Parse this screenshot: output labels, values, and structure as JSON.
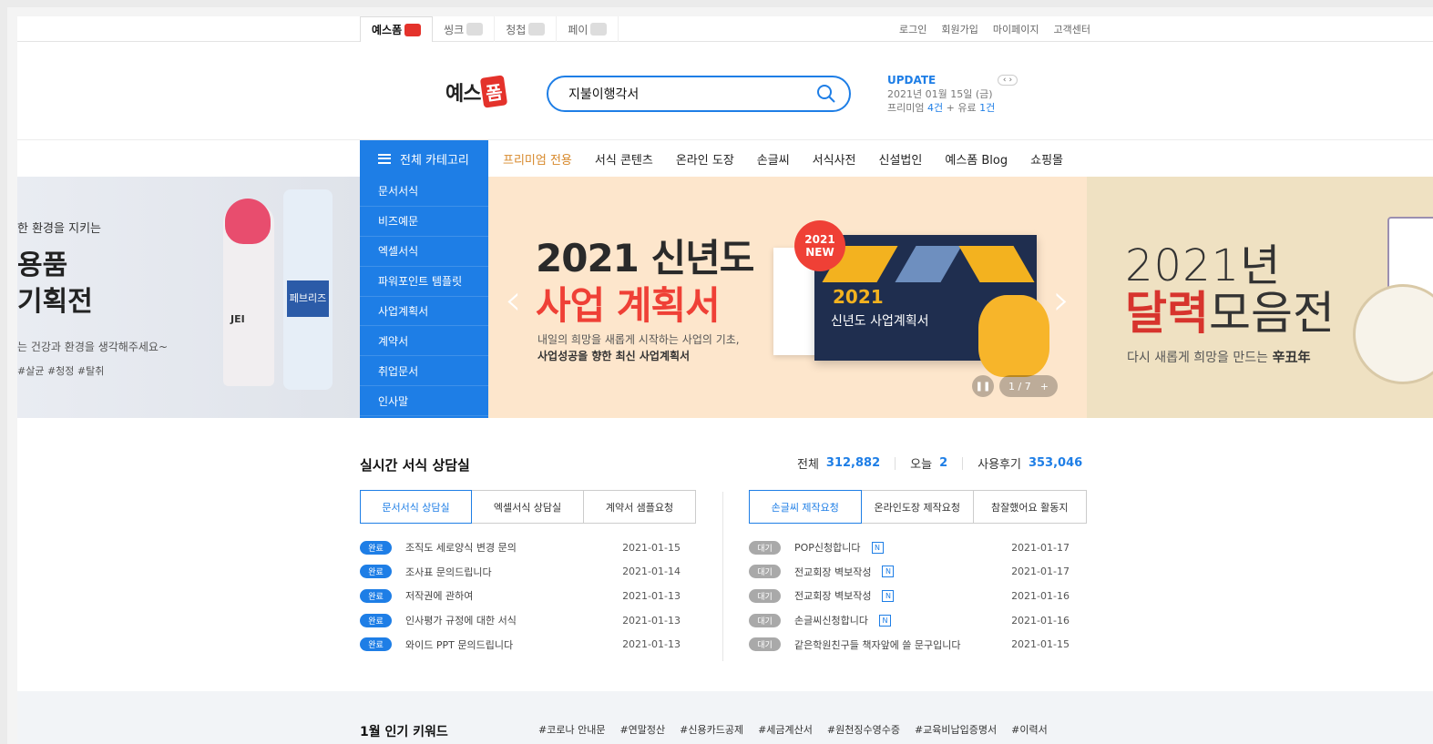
{
  "site_tabs": [
    {
      "label": "예스폼",
      "active": true
    },
    {
      "label": "씽크",
      "active": false
    },
    {
      "label": "청첩",
      "active": false
    },
    {
      "label": "페이",
      "active": false
    }
  ],
  "util_links": [
    "로그인",
    "회원가입",
    "마이페이지",
    "고객센터"
  ],
  "logo": {
    "part1": "예스",
    "part2": "폼"
  },
  "search": {
    "value": "지불이행각서"
  },
  "update": {
    "label": "UPDATE",
    "date": "2021년 01월 15일 (금)",
    "premium_label": "프리미엄",
    "premium_count": "4건",
    "paid_label": "유료",
    "paid_count": "1건"
  },
  "nav": {
    "all_category": "전체 카테고리",
    "items": [
      "프리미엄 전용",
      "서식 콘텐츠",
      "온라인 도장",
      "손글씨",
      "서식사전",
      "신설법인",
      "예스폼 Blog",
      "쇼핑몰"
    ]
  },
  "category_menu": [
    "문서서식",
    "비즈예문",
    "엑셀서식",
    "파워포인트 템플릿",
    "사업계획서",
    "계약서",
    "취업문서",
    "인사말"
  ],
  "banner_left": {
    "small": "한 환경을 지키는",
    "big1": "용품",
    "big2": "기획전",
    "desc": "는 건강과 환경을 생각해주세요~",
    "tags": "#살균  #청정  #탈취",
    "bottle_label": "페브리즈",
    "bottle_brand": "JEI"
  },
  "banner_center": {
    "headline1": "2021 신년도",
    "headline2": "사업 계획서",
    "sub1": "내일의 희망을 새롭게 시작하는 사업의 기초,",
    "sub2": "사업성공을 향한 최신 사업계획서",
    "badge_year": "2021",
    "badge_new": "NEW",
    "doc_year": "2021",
    "doc_title": "신년도 사업계획서",
    "slide_counter": "1 / 7",
    "pause_icon": "pause-icon",
    "plus_label": "+"
  },
  "banner_right": {
    "year": "2021년",
    "big_red": "달력",
    "big_rest": "모음전",
    "sub": "다시 새롭게 희망을 만드는",
    "sub_bold": "辛丑年"
  },
  "consult": {
    "title": "실시간 서식 상담실",
    "stats": [
      {
        "label": "전체",
        "value": "312,882"
      },
      {
        "label": "오늘",
        "value": "2"
      },
      {
        "label": "사용후기",
        "value": "353,046"
      }
    ],
    "left_tabs": [
      "문서서식 상담실",
      "엑셀서식 상담실",
      "계약서 샘플요청"
    ],
    "right_tabs": [
      "손글씨 제작요청",
      "온라인도장 제작요청",
      "참잘했어요 활동지"
    ],
    "left_rows": [
      {
        "status": "완료",
        "title": "조직도 세로양식 변경 문의",
        "date": "2021-01-15"
      },
      {
        "status": "완료",
        "title": "조사표 문의드립니다",
        "date": "2021-01-14"
      },
      {
        "status": "완료",
        "title": "저작권에 관하여",
        "date": "2021-01-13"
      },
      {
        "status": "완료",
        "title": "인사평가 규정에 대한 서식",
        "date": "2021-01-13"
      },
      {
        "status": "완료",
        "title": "와이드 PPT 문의드립니다",
        "date": "2021-01-13"
      }
    ],
    "right_rows": [
      {
        "status": "대기",
        "title": "POP신청합니다",
        "new": "N",
        "date": "2021-01-17"
      },
      {
        "status": "대기",
        "title": "전교회장 벽보작성",
        "new": "N",
        "date": "2021-01-17"
      },
      {
        "status": "대기",
        "title": "전교회장 벽보작성",
        "new": "N",
        "date": "2021-01-16"
      },
      {
        "status": "대기",
        "title": "손글씨신청합니다",
        "new": "N",
        "date": "2021-01-16"
      },
      {
        "status": "대기",
        "title": "같은학원친구들 책자앞에 쓸 문구입니다",
        "new": "",
        "date": "2021-01-15"
      }
    ]
  },
  "keywords": {
    "title": "1월 인기 키워드",
    "items": [
      "#코로나 안내문",
      "#연말정산",
      "#신용카드공제",
      "#세금계산서",
      "#원천징수영수증",
      "#교육비납입증명서",
      "#이력서"
    ]
  },
  "colors": {
    "accent": "#1e7ee6",
    "brand_red": "#e4322b",
    "premium": "#d7882a"
  }
}
